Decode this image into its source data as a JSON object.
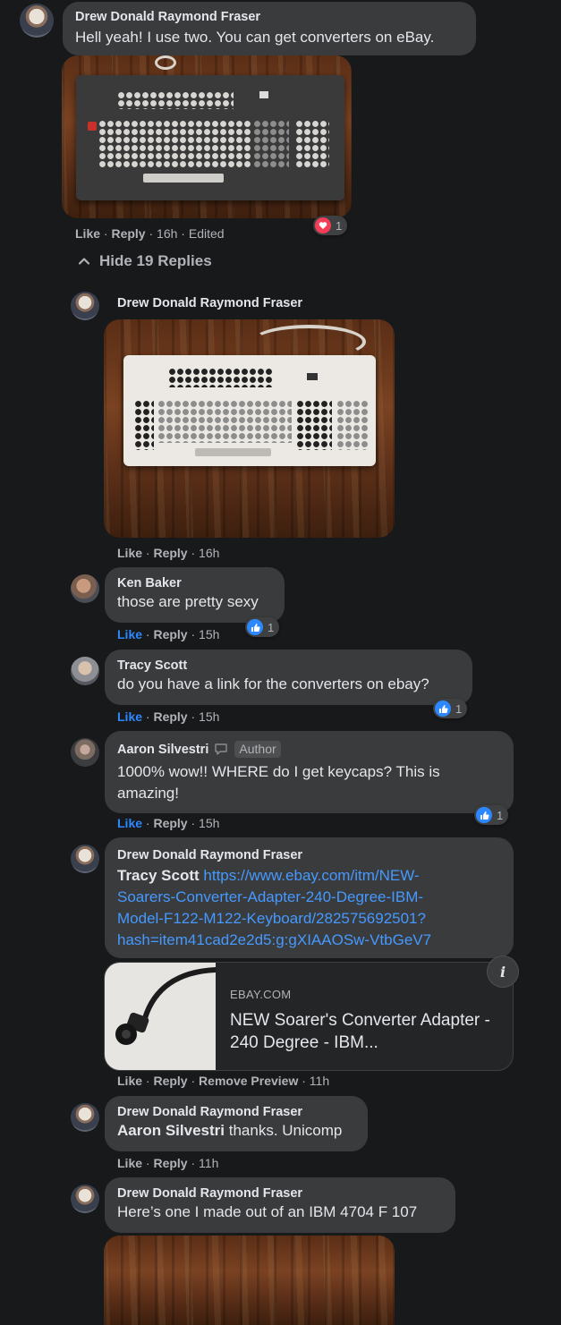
{
  "comments": {
    "top": {
      "author": "Drew Donald Raymond Fraser",
      "text": "Hell yeah! I use two. You can get converters on eBay.",
      "like": "Like",
      "reply": "Reply",
      "time": "16h",
      "edited": "Edited",
      "reaction_count": "1"
    },
    "toggle": "Hide 19 Replies",
    "replies": [
      {
        "author": "Drew Donald Raymond Fraser",
        "like": "Like",
        "reply": "Reply",
        "time": "16h"
      },
      {
        "author": "Ken Baker",
        "text": "those are pretty sexy",
        "like": "Like",
        "reply": "Reply",
        "time": "15h",
        "reaction_count": "1"
      },
      {
        "author": "Tracy Scott",
        "text": "do you have a link for the converters on ebay?",
        "like": "Like",
        "reply": "Reply",
        "time": "15h",
        "reaction_count": "1"
      },
      {
        "author": "Aaron Silvestri",
        "badge": "Author",
        "text_line1": "1000% wow!! WHERE do I get keycaps? This is",
        "text_line2": "amazing!",
        "like": "Like",
        "reply": "Reply",
        "time": "15h",
        "reaction_count": "1"
      },
      {
        "author": "Drew Donald Raymond Fraser",
        "mention": "Tracy Scott",
        "link_lines": [
          "https://www.ebay.com/itm/NEW-",
          "Soarers-Converter-Adapter-240-Degree-IBM-",
          "Model-F122-M122-Keyboard/282575692501?",
          "hash=item41cad2e2d5:g:gXIAAOSw-VtbGeV7"
        ],
        "preview": {
          "domain": "EBAY.COM",
          "title": "NEW Soarer's Converter Adapter - 240 Degree - IBM..."
        },
        "like": "Like",
        "reply": "Reply",
        "remove_preview": "Remove Preview",
        "time": "11h"
      },
      {
        "author": "Drew Donald Raymond Fraser",
        "mention": "Aaron Silvestri",
        "text": "thanks. Unicomp",
        "like": "Like",
        "reply": "Reply",
        "time": "11h"
      },
      {
        "author": "Drew Donald Raymond Fraser",
        "text": "Here’s one I made out of an IBM 4704 F 107"
      }
    ]
  },
  "colors": {
    "background": "#18191a",
    "bubble": "#3a3b3c",
    "link": "#4599ff",
    "like_active": "#2d88ff",
    "heart": "#f33e58"
  }
}
